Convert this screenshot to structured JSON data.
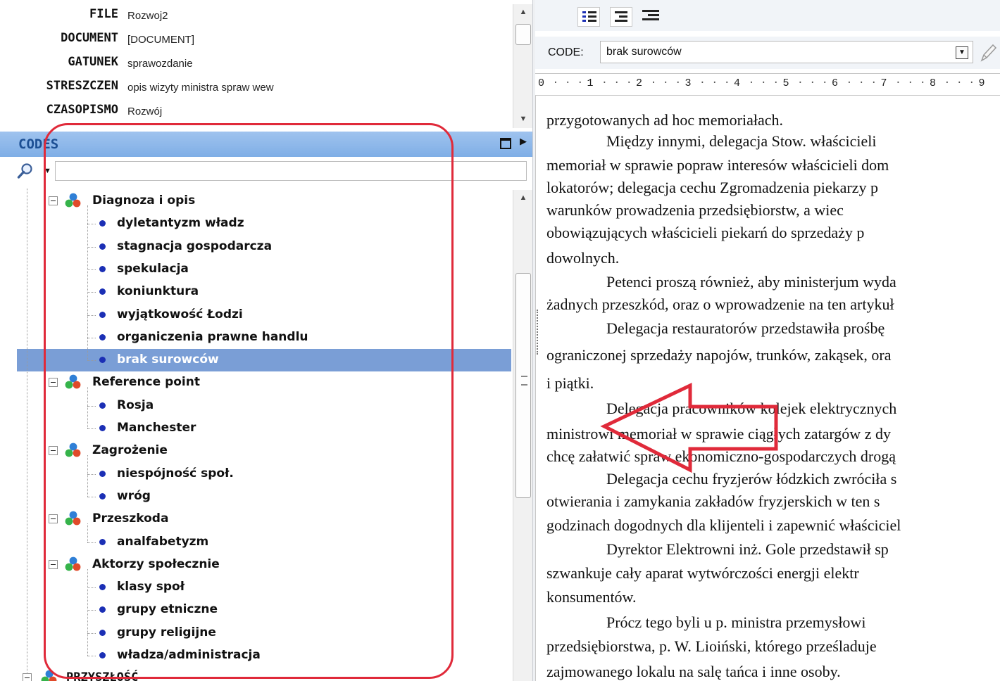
{
  "metadata": {
    "fields": [
      {
        "key": "FILE",
        "value": "Rozwoj2"
      },
      {
        "key": "DOCUMENT",
        "value": "[DOCUMENT]"
      },
      {
        "key": "GATUNEK",
        "value": "sprawozdanie"
      },
      {
        "key": "STRESZCZEN",
        "value": "opis wizyty ministra spraw wew"
      },
      {
        "key": "CZASOPISMO",
        "value": "Rozwój"
      }
    ]
  },
  "codes_panel": {
    "title": "CODES",
    "search_value": "",
    "tree": {
      "categories": [
        {
          "label": "Diagnoza i opis",
          "children": [
            "dyletantyzm władz",
            "stagnacja gospodarcza",
            "spekulacja",
            "koniunktura",
            "wyjątkowość Łodzi",
            "organiczenia prawne handlu",
            "brak surowców"
          ]
        },
        {
          "label": "Reference point",
          "children": [
            "Rosja",
            "Manchester"
          ]
        },
        {
          "label": "Zagrożenie",
          "children": [
            "niespójność społ.",
            "wróg"
          ]
        },
        {
          "label": "Przeszkoda",
          "children": [
            "analfabetyzm"
          ]
        },
        {
          "label": "Aktorzy społecznie",
          "children": [
            "klasy społ",
            "grupy etniczne",
            "grupy religijne",
            "władza/administracja"
          ]
        }
      ],
      "selected": "brak surowców",
      "root_next": "PRZYSZŁOŚĆ"
    }
  },
  "code_bar": {
    "label": "CODE:",
    "value": "brak surowców"
  },
  "ruler": {
    "numbers": [
      "0",
      "1",
      "2",
      "3",
      "4",
      "5",
      "6",
      "7",
      "8",
      "9"
    ]
  },
  "document": {
    "lines": [
      {
        "text": "przygotowanych ad hoc memoriałach.",
        "indent": false
      },
      {
        "text": "Między innymi, delegacja Stow. właścicieli",
        "indent": true
      },
      {
        "text": "memoriał w sprawie popraw interesów właścicieli dom",
        "indent": false
      },
      {
        "text": "lokatorów; delegacja cechu Zgromadzenia piekarzy p",
        "indent": false
      },
      {
        "text": "warunków prowadzenia przedsiębiorstw, a wiec",
        "indent": false
      },
      {
        "text": "obowiązujących właścicieli piekarń do sprzedaży p",
        "indent": false
      },
      {
        "text": "dowolnych.",
        "indent": false
      },
      {
        "text": "Petenci proszą również, aby ministerjum wyda",
        "indent": true
      },
      {
        "text": "żadnych przeszkód, oraz o wprowadzenie na ten artykuł",
        "indent": false
      },
      {
        "text": "Delegacja restauratorów przedstawiła prośbę",
        "indent": true
      },
      {
        "text": "ograniczonej sprzedaży napojów, trunków, zakąsek, ora",
        "indent": false
      },
      {
        "text": "i piątki.",
        "indent": false
      },
      {
        "text": "Delegacja pracowników kolejek elektrycznych",
        "indent": true
      },
      {
        "text": "ministrowi memoriał w sprawie ciągłych zatargów z dy",
        "indent": false
      },
      {
        "text": "chcę załatwić spraw ekonomiczno-gospodarczych drogą",
        "indent": false
      },
      {
        "text": "Delegacja cechu fryzjerów łódzkich zwróciła s",
        "indent": true
      },
      {
        "text": "otwierania i zamykania zakładów fryzjerskich w ten s",
        "indent": false
      },
      {
        "text": "godzinach dogodnych dla klijenteli i zapewnić właściciel",
        "indent": false
      },
      {
        "text": "Dyrektor Elektrowni inż. Gole przedstawił sp",
        "indent": true
      },
      {
        "text": "szwankuje cały aparat wytwórczości energji elektr",
        "indent": false
      },
      {
        "text": "konsumentów.",
        "indent": false
      },
      {
        "text": "Prócz tego byli u p. ministra przemysłowi",
        "indent": true
      },
      {
        "text": "przedsiębiorstwa, p. W. Lioiński, którego prześladuje",
        "indent": false
      },
      {
        "text": "zajmowanego lokalu na salę tańca i inne osoby.",
        "indent": false
      }
    ]
  },
  "colors": {
    "selection": "#7a9ed6",
    "codes_header": "#8cb6ea",
    "annotation": "#e02a3a",
    "leaf_dot": "#1b2fb5"
  }
}
